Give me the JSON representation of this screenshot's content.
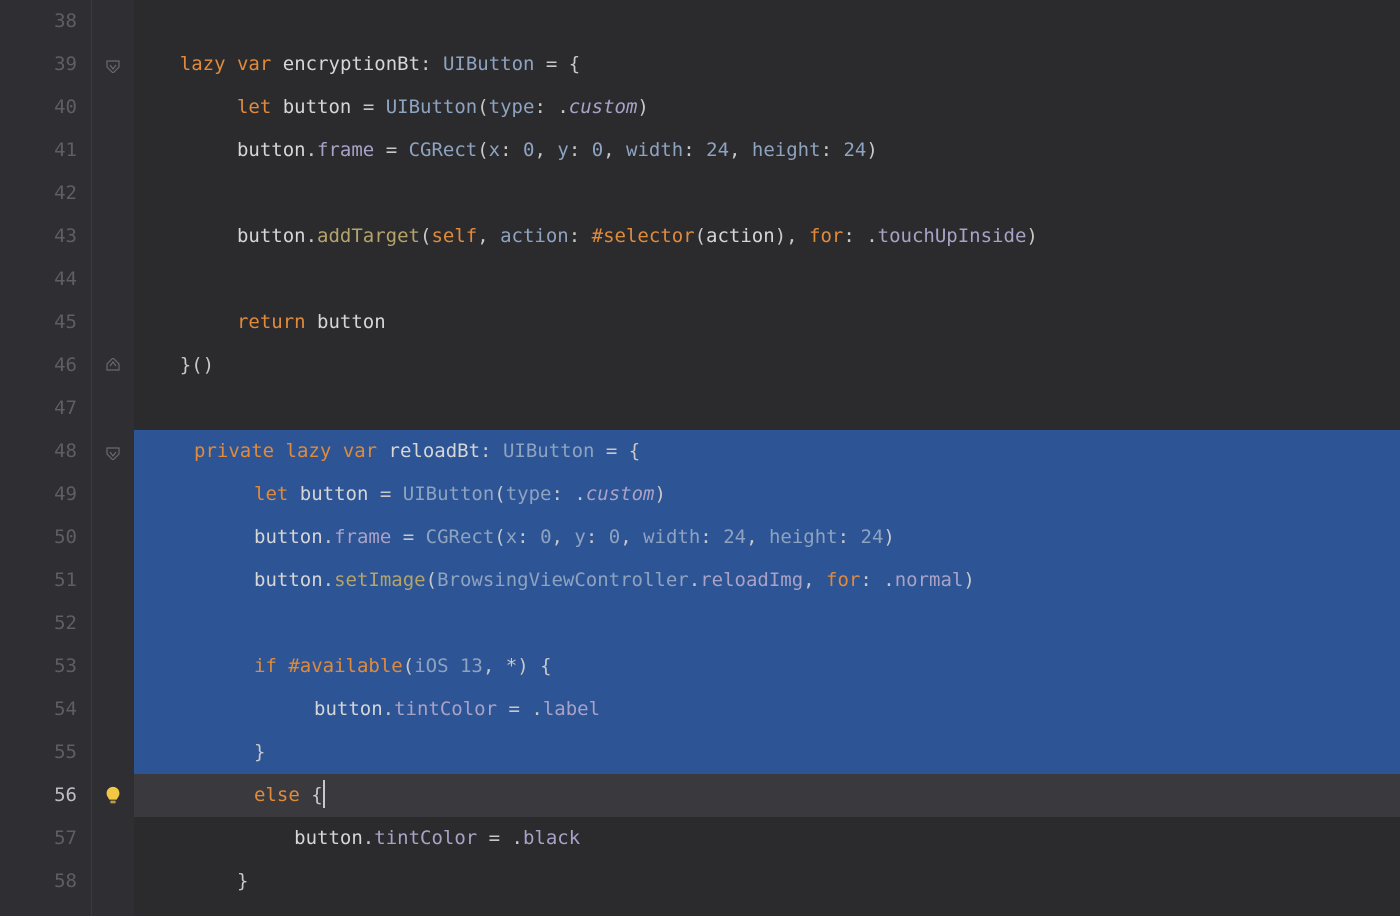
{
  "gutter": {
    "lines": [
      38,
      39,
      40,
      41,
      42,
      43,
      44,
      45,
      46,
      47,
      48,
      49,
      50,
      51,
      52,
      53,
      54,
      55,
      56,
      57,
      58
    ],
    "active_line": 56
  },
  "fold": {
    "markers": {
      "39": "open",
      "46": "close",
      "48": "open"
    },
    "bulb_line": 56
  },
  "selection": {
    "start": 48,
    "end": 56
  },
  "tokens": {
    "lazy": "lazy",
    "var": "var",
    "let": "let",
    "private": "private",
    "return": "return",
    "if": "if",
    "else": "else",
    "self": "self",
    "for_kw": "for",
    "selector_kw": "#selector",
    "encryptionBt": "encryptionBt",
    "reloadBt": "reloadBt",
    "button": "button",
    "UIButton": "UIButton",
    "type": "type",
    "custom": "custom",
    "frame": "frame",
    "CGRect": "CGRect",
    "x": "x",
    "y": "y",
    "width": "width",
    "height": "height",
    "n0": "0",
    "n24": "24",
    "n13": "13",
    "addTarget": "addTarget",
    "action_lbl": "action",
    "action_ident": "action",
    "touchUpInside": "touchUpInside",
    "setImage": "setImage",
    "BrowsingViewController": "BrowsingViewController",
    "reloadImg": "reloadImg",
    "normal": "normal",
    "available": "#available",
    "iOS": "iOS",
    "star": "*",
    "tintColor": "tintColor",
    "label": "label",
    "black": "black"
  }
}
